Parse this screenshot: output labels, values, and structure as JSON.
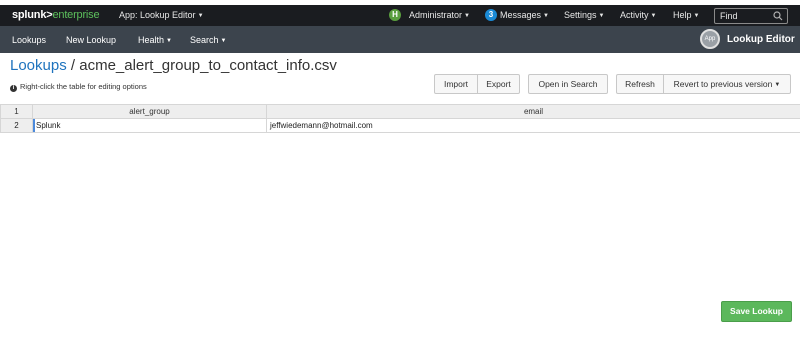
{
  "topbar": {
    "logo_brand": "splunk>",
    "logo_product": "enterprise",
    "app_menu": "App: Lookup Editor",
    "user_initial": "H",
    "user_name": "Administrator",
    "messages_count": "3",
    "messages_label": "Messages",
    "settings_label": "Settings",
    "activity_label": "Activity",
    "help_label": "Help",
    "find_placeholder": "Find"
  },
  "appbar": {
    "nav": [
      "Lookups",
      "New Lookup",
      "Health",
      "Search"
    ],
    "app_icon_label": "App",
    "app_name": "Lookup Editor"
  },
  "page": {
    "breadcrumb_root": "Lookups",
    "separator": " / ",
    "filename": "acme_alert_group_to_contact_info.csv",
    "hint": "Right-click the table for editing options"
  },
  "buttons": {
    "import": "Import",
    "export": "Export",
    "open_in_search": "Open in Search",
    "refresh": "Refresh",
    "revert": "Revert to previous version",
    "save": "Save Lookup"
  },
  "table": {
    "corner": "1",
    "columns": [
      "alert_group",
      "email"
    ],
    "rows": [
      {
        "num": "2",
        "cells": [
          "Splunk",
          "jeffwiedemann@hotmail.com"
        ]
      }
    ]
  },
  "colors": {
    "topbar_bg": "#1a1c20",
    "appbar_bg": "#3c444d",
    "link": "#1e73be",
    "save_green": "#5cb85c",
    "logo_green": "#5cc05c"
  }
}
